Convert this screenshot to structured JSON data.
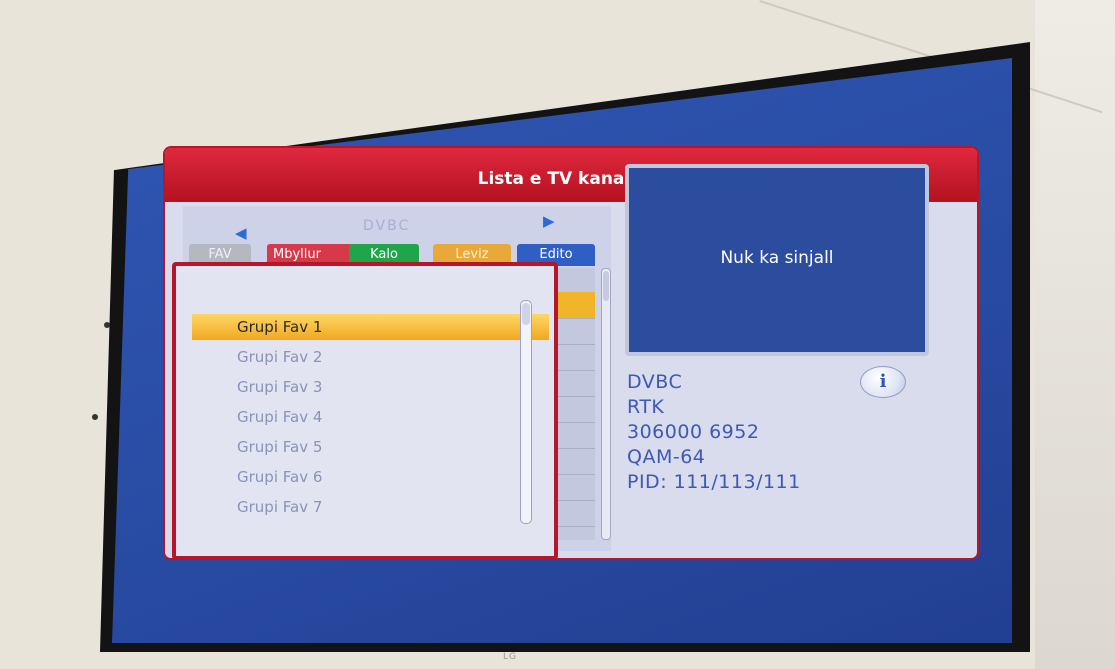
{
  "window": {
    "title": "Lista e TV kanaleve"
  },
  "navigation": {
    "network_label": "DVBC"
  },
  "tabs": {
    "fav": "FAV",
    "close": "Mbyllur",
    "skip": "Kalo",
    "move": "Leviz",
    "edit": "Edito"
  },
  "favorite_groups": [
    "Grupi Fav 1",
    "Grupi Fav 2",
    "Grupi Fav 3",
    "Grupi Fav 4",
    "Grupi Fav 5",
    "Grupi Fav 6",
    "Grupi Fav 7"
  ],
  "selected_group_index": 0,
  "preview": {
    "status_text": "Nuk ka sinjall"
  },
  "channel_info": {
    "network": "DVBC",
    "provider": "RTK",
    "frequency_symbol": "306000  6952",
    "modulation": "QAM-64",
    "pid": "PID: 111/113/111"
  },
  "icons": {
    "info": "i"
  },
  "colors": {
    "title_bar": "#c8172a",
    "tab_red": "#d63a4a",
    "tab_green": "#20a64a",
    "tab_yellow": "#e8a93a",
    "tab_blue": "#2f5fc4",
    "highlight": "#f1b52a",
    "screen_bg": "#2a4ea6"
  },
  "brand": {
    "tv_logo": "LG"
  }
}
